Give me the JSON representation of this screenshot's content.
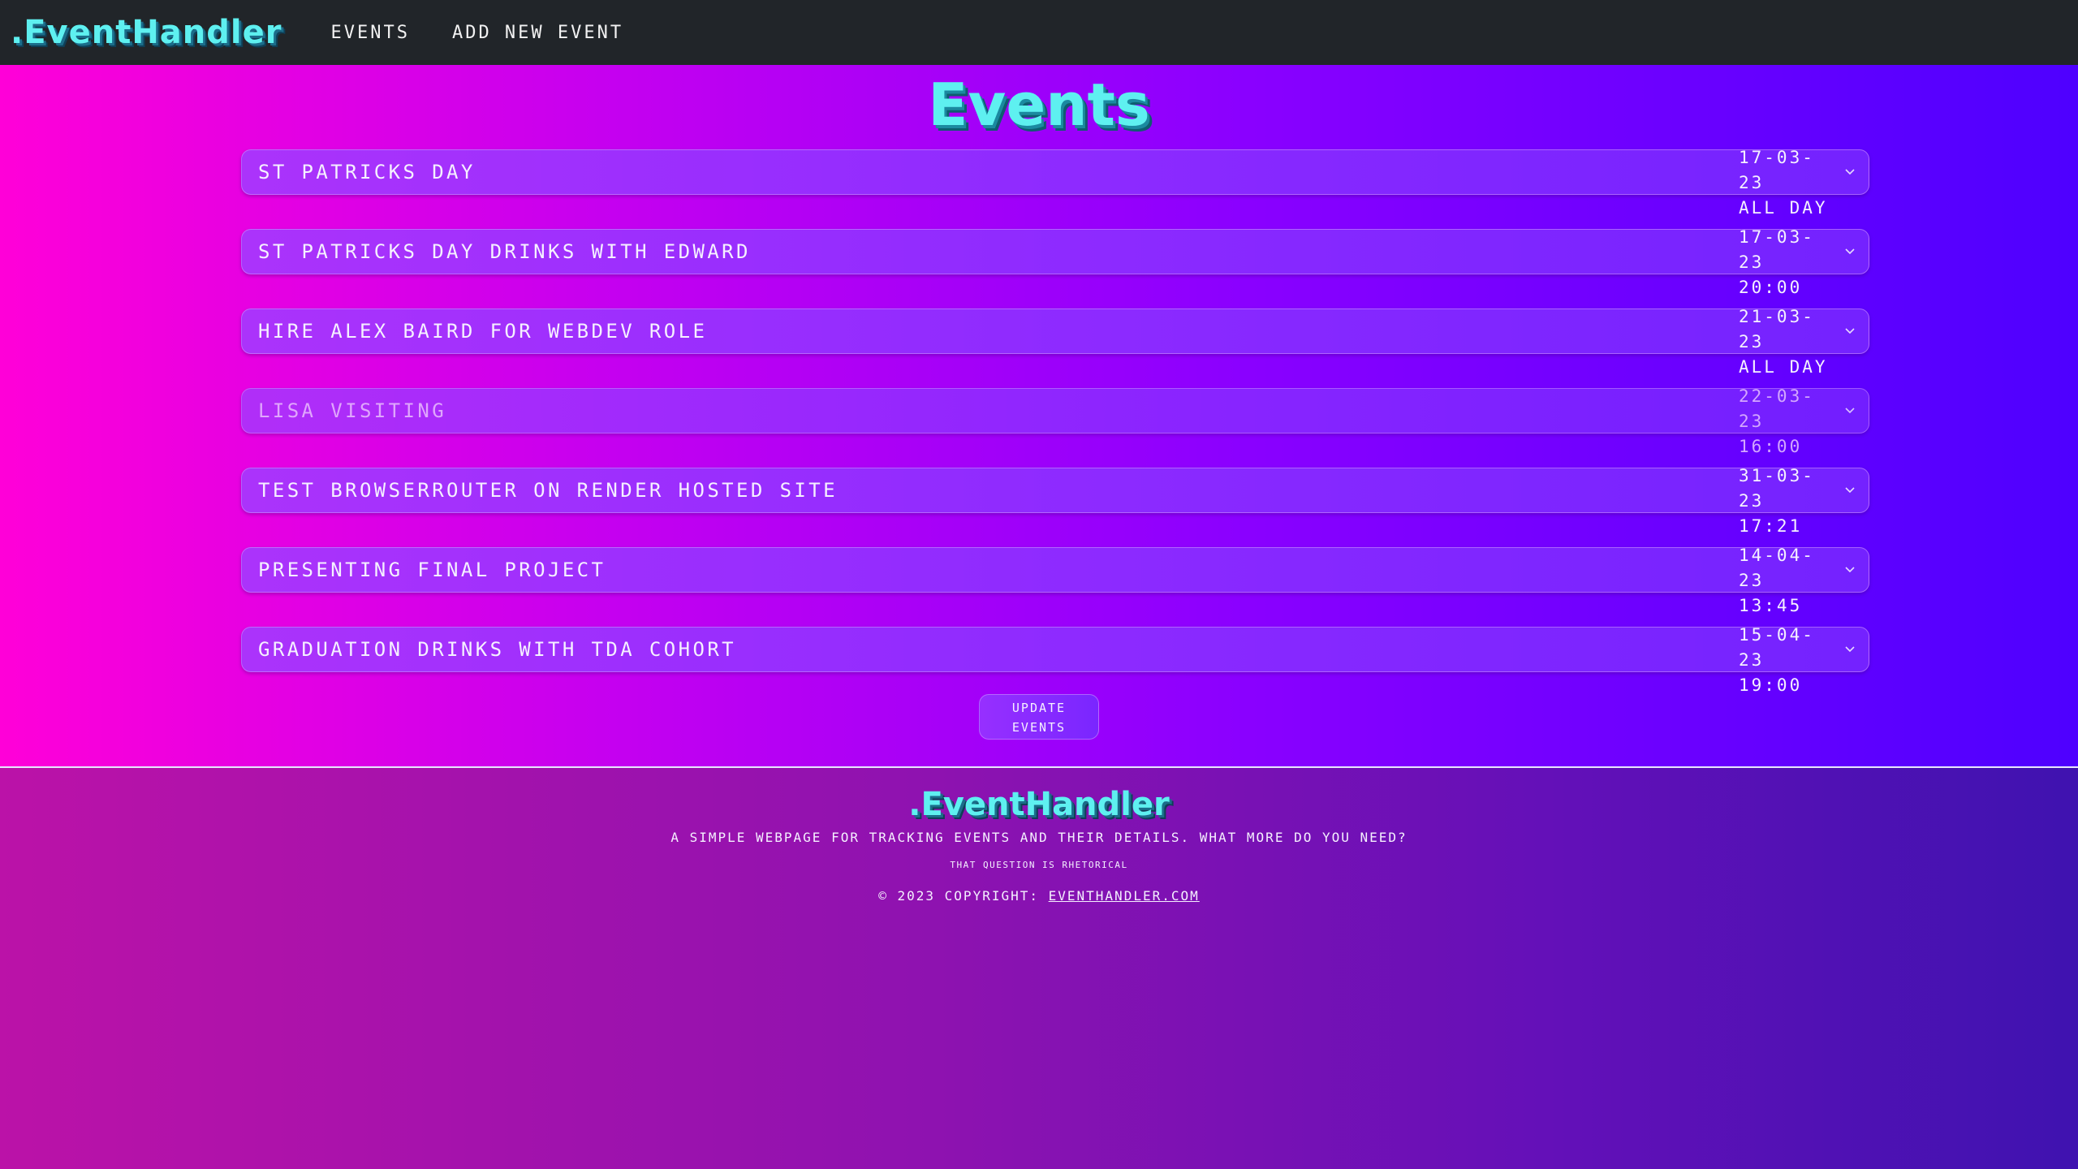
{
  "navbar": {
    "brand": ".EventHandler",
    "links": [
      "Events",
      "Add New Event"
    ]
  },
  "page": {
    "title": "Events"
  },
  "events": [
    {
      "title": "St Patricks Day",
      "date": "17-03-23",
      "time": "All Day",
      "dim": false
    },
    {
      "title": "St Patricks Day Drinks With Edward",
      "date": "17-03-23",
      "time": "20:00",
      "dim": false
    },
    {
      "title": "Hire Alex Baird For Webdev Role",
      "date": "21-03-23",
      "time": "All Day",
      "dim": false
    },
    {
      "title": "Lisa Visiting",
      "date": "22-03-23",
      "time": "16:00",
      "dim": true
    },
    {
      "title": "Test Browserrouter On Render Hosted Site",
      "date": "31-03-23",
      "time": "17:21",
      "dim": false
    },
    {
      "title": "Presenting Final Project",
      "date": "14-04-23",
      "time": "13:45",
      "dim": false
    },
    {
      "title": "Graduation Drinks With TDA Cohort",
      "date": "15-04-23",
      "time": "19:00",
      "dim": false
    }
  ],
  "update_button": {
    "line1": "Update",
    "line2": "Events"
  },
  "footer": {
    "brand": ".EventHandler",
    "tagline": "A simple webpage for tracking events and their details. What more do you need?",
    "note": "That question is rhetorical",
    "copyright_prefix": "© 2023 Copyright: ",
    "link": "EventHandler.com"
  },
  "colors": {
    "brand_cyan": "#5ef0f0",
    "navbar_bg": "#212529"
  }
}
